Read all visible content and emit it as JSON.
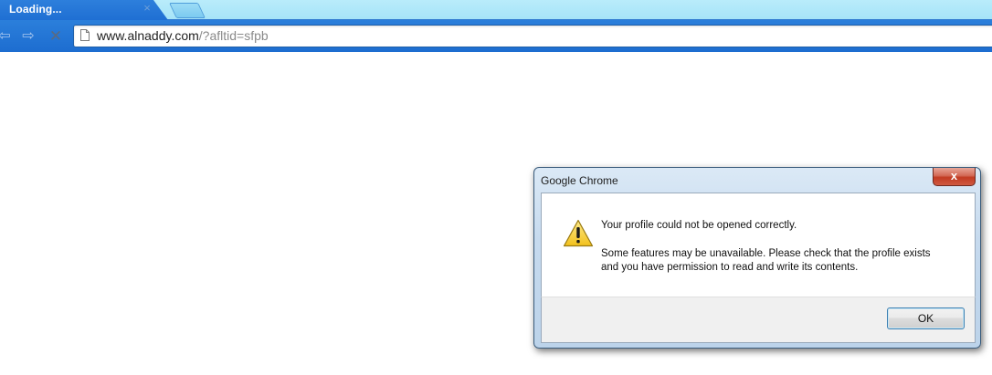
{
  "browser": {
    "tab": {
      "title": "Loading...",
      "close_glyph": "×"
    },
    "toolbar": {
      "back_glyph": "⇦",
      "forward_glyph": "⇨",
      "stop_glyph": "✕",
      "url_host": "www.alnaddy.com",
      "url_path": "/?afltid=sfpb"
    }
  },
  "dialog": {
    "title": "Google Chrome",
    "close_glyph": "x",
    "icon": "warning-icon",
    "message_main": "Your profile could not be opened correctly.",
    "message_detail": "Some features may be unavailable.  Please check that the profile exists\nand you have permission to read and write its contents.",
    "ok_label": "OK"
  },
  "colors": {
    "tab_blue": "#2d7fdc",
    "toolbar_blue": "#1d6dd0",
    "close_red": "#c23b22",
    "warning_yellow": "#f6d33b"
  }
}
